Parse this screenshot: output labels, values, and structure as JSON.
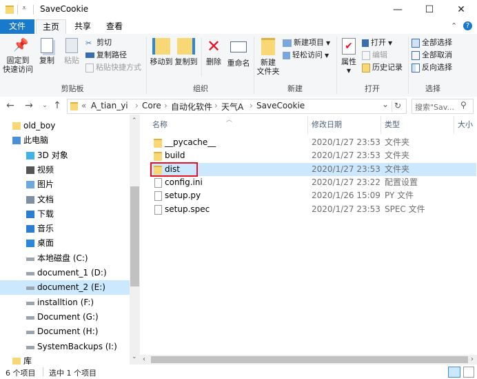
{
  "window": {
    "title": "SaveCookie",
    "controls": {
      "minimize": "—",
      "maximize": "☐",
      "close": "✕"
    }
  },
  "ribbon_tabs": [
    "文件",
    "主页",
    "共享",
    "查看"
  ],
  "ribbon": {
    "clipboard": {
      "pin": "固定到\n快速访问",
      "pin_line1": "固定到",
      "pin_line2": "快速访问",
      "copy": "复制",
      "paste": "粘贴",
      "cut": "剪切",
      "copy_path": "复制路径",
      "paste_shortcut": "粘贴快捷方式",
      "label": "剪贴板"
    },
    "organize": {
      "move_to": "移动到",
      "copy_to": "复制到",
      "delete": "删除",
      "rename": "重命名",
      "label": "组织"
    },
    "new": {
      "new_folder_line1": "新建",
      "new_folder_line2": "文件夹",
      "new_item": "新建项目",
      "easy_access": "轻松访问",
      "label": "新建"
    },
    "open": {
      "properties": "属性",
      "open": "打开",
      "edit": "编辑",
      "history": "历史记录",
      "label": "打开"
    },
    "select": {
      "select_all": "全部选择",
      "select_none": "全部取消",
      "invert": "反向选择",
      "label": "选择"
    }
  },
  "address": {
    "breadcrumbs": [
      "«",
      "A_tian_yi",
      "Core",
      "自动化软件",
      "天气A",
      "SaveCookie"
    ],
    "search_placeholder": "搜索\"Sav...",
    "dropdown": "⌄",
    "refresh": "↻"
  },
  "nav_pane": {
    "items": [
      {
        "label": "old_boy",
        "icon": "user-folder-icon",
        "selected": false,
        "indent": 1
      },
      {
        "label": "此电脑",
        "icon": "computer-icon",
        "selected": false,
        "indent": 1
      },
      {
        "label": "3D 对象",
        "icon": "3d-objects-icon",
        "selected": false,
        "indent": 2
      },
      {
        "label": "视频",
        "icon": "video-icon",
        "selected": false,
        "indent": 2
      },
      {
        "label": "图片",
        "icon": "pictures-icon",
        "selected": false,
        "indent": 2
      },
      {
        "label": "文档",
        "icon": "documents-icon",
        "selected": false,
        "indent": 2
      },
      {
        "label": "下载",
        "icon": "download-icon",
        "selected": false,
        "indent": 2
      },
      {
        "label": "音乐",
        "icon": "music-icon",
        "selected": false,
        "indent": 2
      },
      {
        "label": "桌面",
        "icon": "desktop-icon",
        "selected": false,
        "indent": 2
      },
      {
        "label": "本地磁盘 (C:)",
        "icon": "drive-icon",
        "selected": false,
        "indent": 2
      },
      {
        "label": "document_1 (D:)",
        "icon": "drive-icon",
        "selected": false,
        "indent": 2
      },
      {
        "label": "document_2 (E:)",
        "icon": "drive-icon",
        "selected": true,
        "indent": 2
      },
      {
        "label": "installtion (F:)",
        "icon": "drive-icon",
        "selected": false,
        "indent": 2
      },
      {
        "label": "Document (G:)",
        "icon": "drive-icon",
        "selected": false,
        "indent": 2
      },
      {
        "label": "Document (H:)",
        "icon": "drive-icon",
        "selected": false,
        "indent": 2
      },
      {
        "label": "SystemBackups (I:)",
        "icon": "drive-icon",
        "selected": false,
        "indent": 2
      },
      {
        "label": "库",
        "icon": "library-icon",
        "selected": false,
        "indent": 1
      }
    ]
  },
  "file_list": {
    "columns": [
      "名称",
      "修改日期",
      "类型",
      "大小"
    ],
    "rows": [
      {
        "name": "__pycache__",
        "date": "2020/1/27 23:53",
        "type": "文件夹",
        "icon": "folder-icon",
        "selected": false,
        "highlighted": false
      },
      {
        "name": "build",
        "date": "2020/1/27 23:53",
        "type": "文件夹",
        "icon": "folder-icon",
        "selected": false,
        "highlighted": false
      },
      {
        "name": "dist",
        "date": "2020/1/27 23:53",
        "type": "文件夹",
        "icon": "folder-icon",
        "selected": true,
        "highlighted": true
      },
      {
        "name": "config.ini",
        "date": "2020/1/27 23:22",
        "type": "配置设置",
        "icon": "config-file-icon",
        "selected": false,
        "highlighted": false
      },
      {
        "name": "setup.py",
        "date": "2020/1/26 15:09",
        "type": "PY 文件",
        "icon": "python-file-icon",
        "selected": false,
        "highlighted": false
      },
      {
        "name": "setup.spec",
        "date": "2020/1/27 23:53",
        "type": "SPEC 文件",
        "icon": "file-icon",
        "selected": false,
        "highlighted": false
      }
    ]
  },
  "status": {
    "item_count": "6 个项目",
    "selected": "选中 1 个项目"
  },
  "colors": {
    "file_tab": "#1979ca",
    "selection": "#cce8ff",
    "highlight_box": "#e81123"
  }
}
